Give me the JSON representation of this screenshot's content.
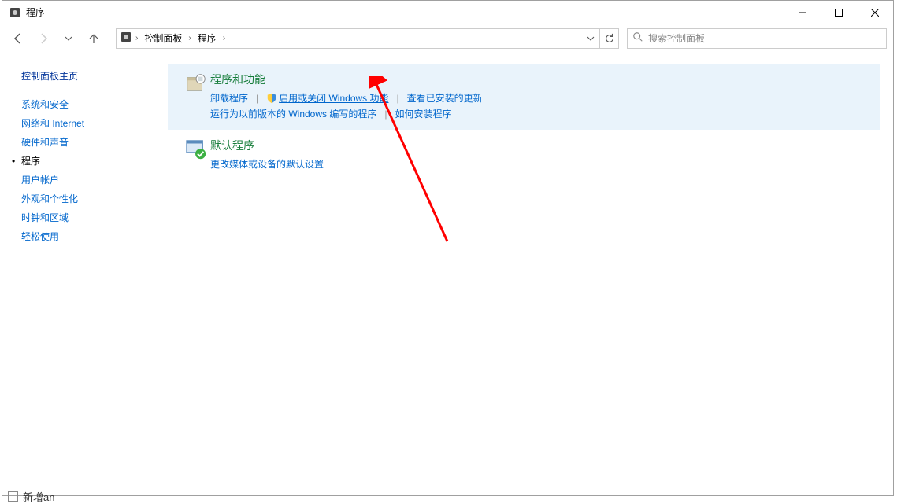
{
  "window": {
    "title": "程序"
  },
  "breadcrumbs": {
    "root": "控制面板",
    "current": "程序"
  },
  "search": {
    "placeholder": "搜索控制面板"
  },
  "sidebar": {
    "home": "控制面板主页",
    "items": [
      "系统和安全",
      "网络和 Internet",
      "硬件和声音",
      "程序",
      "用户帐户",
      "外观和个性化",
      "时钟和区域",
      "轻松使用"
    ],
    "current_index": 3
  },
  "sections": {
    "programs": {
      "title": "程序和功能",
      "links": {
        "uninstall": "卸载程序",
        "features": "启用或关闭 Windows 功能",
        "updates": "查看已安装的更新",
        "oldwin": "运行为以前版本的 Windows 编写的程序",
        "howinstall": "如何安装程序"
      }
    },
    "defaults": {
      "title": "默认程序",
      "links": {
        "media": "更改媒体或设备的默认设置"
      }
    }
  },
  "below": {
    "text": "新增an"
  }
}
